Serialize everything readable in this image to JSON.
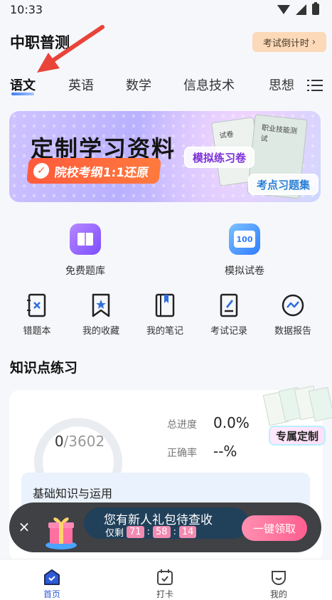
{
  "status_bar": {
    "time": "10:33"
  },
  "header": {
    "app_title": "中职普测",
    "countdown_label": "考试倒计时"
  },
  "tabs": [
    {
      "label": "语文",
      "active": true
    },
    {
      "label": "英语"
    },
    {
      "label": "数学"
    },
    {
      "label": "信息技术"
    },
    {
      "label": "思想"
    }
  ],
  "banner": {
    "headline": "定制学习资料",
    "pill_text": "院校考纲1:1还原",
    "tag_mock": "模拟练习卷",
    "tag_points": "考点习题集",
    "book_text_1": "职业技能测试",
    "book_text_2": "试卷"
  },
  "features": [
    {
      "label": "免费题库",
      "icon": "book-bank-icon"
    },
    {
      "label": "模拟试卷",
      "icon": "exam-100-icon",
      "badge": "100"
    }
  ],
  "tools": [
    {
      "label": "错题本",
      "icon": "wrong-book-icon"
    },
    {
      "label": "我的收藏",
      "icon": "bookmark-star-icon"
    },
    {
      "label": "我的笔记",
      "icon": "notes-icon"
    },
    {
      "label": "考试记录",
      "icon": "exam-record-icon"
    },
    {
      "label": "数据报告",
      "icon": "data-report-icon"
    }
  ],
  "practice": {
    "section_title": "知识点练习",
    "done": "0",
    "total": "/3602",
    "progress_label": "总进度",
    "progress_value": "0.0%",
    "accuracy_label": "正确率",
    "accuracy_value": "--%",
    "custom_label": "专属定制",
    "topic": "基础知识与运用"
  },
  "promo": {
    "close": "×",
    "title": "您有新人礼包待查收",
    "remaining_label": "仅剩",
    "hours": "71",
    "minutes": "58",
    "seconds": "14",
    "claim_label": "一键领取"
  },
  "bottom_nav": [
    {
      "label": "首页",
      "active": true
    },
    {
      "label": "打卡"
    },
    {
      "label": "我的"
    }
  ],
  "colors": {
    "accent": "#2f5bd8",
    "promo_pink": "#ff5f91",
    "countdown_bg": "#fcd9b8"
  }
}
